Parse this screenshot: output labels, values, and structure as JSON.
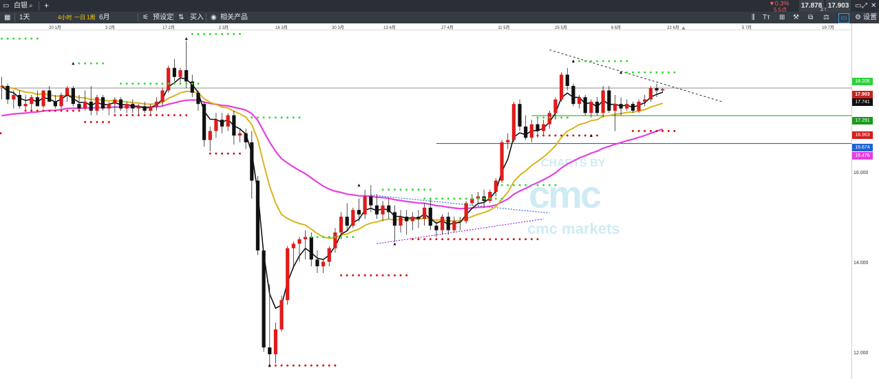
{
  "topbar": {
    "instrument": "白银",
    "change_pct": "▼0.3%",
    "change_pts": "5.5点",
    "bid": "17.878",
    "spread": "2.5",
    "ask": "17.903"
  },
  "toolbar": {
    "timeframe": "1天",
    "periods": [
      "4小时",
      "一日",
      "1周"
    ],
    "range": "6月",
    "presets_label": "预设定",
    "buy_label": "买入",
    "related_label": "相关产品",
    "settings_label": "设置"
  },
  "price_labels": {
    "upper_dots": "18.206",
    "current": "17.903",
    "ma_black": "17.741",
    "green_line": "17.291",
    "lower_dots": "16.963",
    "blue_line": "16.674",
    "magenta_ma": "16.476"
  },
  "watermark": {
    "line1": "CHARTS BY",
    "line2": "cmc markets"
  },
  "colors": {
    "up": "#e01b1b",
    "down": "#111111",
    "ma_fast": "#111111",
    "ma_mid": "#d8b41a",
    "ma_slow": "#e63ee0",
    "dots_high": "#33dd33",
    "dots_low": "#dd1111",
    "support": "#1a9a1a",
    "blue_level": "#1e64d0",
    "trend_blue": "#2a70d8",
    "trend_purple": "#9a2ae0"
  },
  "chart_data": {
    "type": "candlestick",
    "ylim": [
      11.45,
      19.2
    ],
    "y_ticks": [
      "12.000",
      "14.000",
      "16.000"
    ],
    "x_labels": [
      "20 1月",
      "3 2月",
      "17 2月",
      "2 3月",
      "16 3月",
      "30 3月",
      "13 4月",
      "27 4月",
      "11 5月",
      "25 5月",
      "8 6月",
      "22 6月",
      "5 7月",
      "19 7月"
    ],
    "candles": [
      [
        17.95,
        18.15,
        17.65,
        17.95
      ],
      [
        17.95,
        18.0,
        17.55,
        17.65
      ],
      [
        17.65,
        17.85,
        17.45,
        17.75
      ],
      [
        17.75,
        17.85,
        17.45,
        17.5
      ],
      [
        17.5,
        17.75,
        17.4,
        17.55
      ],
      [
        17.55,
        17.75,
        17.4,
        17.7
      ],
      [
        17.7,
        17.85,
        17.5,
        17.5
      ],
      [
        17.5,
        17.85,
        17.45,
        17.85
      ],
      [
        17.85,
        17.95,
        17.6,
        17.6
      ],
      [
        17.6,
        17.75,
        17.45,
        17.5
      ],
      [
        17.5,
        17.8,
        17.45,
        17.75
      ],
      [
        17.75,
        17.95,
        17.6,
        17.9
      ],
      [
        17.9,
        17.95,
        17.5,
        17.55
      ],
      [
        17.55,
        17.75,
        17.4,
        17.45
      ],
      [
        17.45,
        17.85,
        17.4,
        17.6
      ],
      [
        17.6,
        17.95,
        17.3,
        17.4
      ],
      [
        17.4,
        17.75,
        17.3,
        17.7
      ],
      [
        17.7,
        17.75,
        17.4,
        17.45
      ],
      [
        17.45,
        17.6,
        17.3,
        17.55
      ],
      [
        17.55,
        17.7,
        17.35,
        17.65
      ],
      [
        17.65,
        17.7,
        17.4,
        17.45
      ],
      [
        17.45,
        17.6,
        17.35,
        17.55
      ],
      [
        17.55,
        17.65,
        17.35,
        17.45
      ],
      [
        17.45,
        17.55,
        17.3,
        17.5
      ],
      [
        17.5,
        17.6,
        17.35,
        17.4
      ],
      [
        17.4,
        17.55,
        17.3,
        17.5
      ],
      [
        17.5,
        17.7,
        17.4,
        17.6
      ],
      [
        17.6,
        17.9,
        17.5,
        17.85
      ],
      [
        17.85,
        18.4,
        17.8,
        18.35
      ],
      [
        18.35,
        18.55,
        18.05,
        18.15
      ],
      [
        18.15,
        18.35,
        18.0,
        18.3
      ],
      [
        18.3,
        18.95,
        17.9,
        18.05
      ],
      [
        18.05,
        18.2,
        17.7,
        17.8
      ],
      [
        17.8,
        17.85,
        17.4,
        17.55
      ],
      [
        17.55,
        17.6,
        16.6,
        16.75
      ],
      [
        16.75,
        17.05,
        16.5,
        16.95
      ],
      [
        16.95,
        17.35,
        16.8,
        17.2
      ],
      [
        17.2,
        17.35,
        16.9,
        17.05
      ],
      [
        17.05,
        17.35,
        16.95,
        17.3
      ],
      [
        17.3,
        17.4,
        16.65,
        16.85
      ],
      [
        16.85,
        17.0,
        16.7,
        16.9
      ],
      [
        16.9,
        17.0,
        16.55,
        16.7
      ],
      [
        16.7,
        16.95,
        15.45,
        15.85
      ],
      [
        15.85,
        15.95,
        14.2,
        14.3
      ],
      [
        14.3,
        14.3,
        12.05,
        12.15
      ],
      [
        12.15,
        13.55,
        11.75,
        12.0
      ],
      [
        12.0,
        12.7,
        11.8,
        12.55
      ],
      [
        12.55,
        13.3,
        12.5,
        13.2
      ],
      [
        13.2,
        14.4,
        13.1,
        14.35
      ],
      [
        14.35,
        14.5,
        13.9,
        14.45
      ],
      [
        14.45,
        14.6,
        14.05,
        14.55
      ],
      [
        14.55,
        14.75,
        14.1,
        14.6
      ],
      [
        14.6,
        14.7,
        13.95,
        14.1
      ],
      [
        14.1,
        14.3,
        13.8,
        13.95
      ],
      [
        13.95,
        14.1,
        13.8,
        14.05
      ],
      [
        14.05,
        14.4,
        13.95,
        14.35
      ],
      [
        14.35,
        14.8,
        14.25,
        14.7
      ],
      [
        14.7,
        15.15,
        14.55,
        15.05
      ],
      [
        15.05,
        15.35,
        14.75,
        14.85
      ],
      [
        14.85,
        15.25,
        14.8,
        15.2
      ],
      [
        15.2,
        15.45,
        14.95,
        15.1
      ],
      [
        15.1,
        15.65,
        15.0,
        15.5
      ],
      [
        15.5,
        15.75,
        15.15,
        15.3
      ],
      [
        15.3,
        15.55,
        15.0,
        15.1
      ],
      [
        15.1,
        15.4,
        14.95,
        15.3
      ],
      [
        15.3,
        15.45,
        15.0,
        15.15
      ],
      [
        15.15,
        15.3,
        14.5,
        14.85
      ],
      [
        14.85,
        15.2,
        14.7,
        15.05
      ],
      [
        15.05,
        15.2,
        14.65,
        14.95
      ],
      [
        14.95,
        15.15,
        14.75,
        15.05
      ],
      [
        15.05,
        15.2,
        14.8,
        15.0
      ],
      [
        15.0,
        15.35,
        14.85,
        15.25
      ],
      [
        15.25,
        15.45,
        14.75,
        14.85
      ],
      [
        14.85,
        14.95,
        14.6,
        14.75
      ],
      [
        14.75,
        15.1,
        14.65,
        15.05
      ],
      [
        15.05,
        15.15,
        14.65,
        14.75
      ],
      [
        14.75,
        15.05,
        14.7,
        14.95
      ],
      [
        14.95,
        15.05,
        14.75,
        14.95
      ],
      [
        14.95,
        15.4,
        14.9,
        15.35
      ],
      [
        15.35,
        15.55,
        15.3,
        15.45
      ],
      [
        15.45,
        15.6,
        15.35,
        15.5
      ],
      [
        15.5,
        15.65,
        15.25,
        15.4
      ],
      [
        15.4,
        15.65,
        15.35,
        15.6
      ],
      [
        15.6,
        15.9,
        15.5,
        15.85
      ],
      [
        15.85,
        16.75,
        15.8,
        16.7
      ],
      [
        16.7,
        16.9,
        16.55,
        16.75
      ],
      [
        16.75,
        17.6,
        16.7,
        17.55
      ],
      [
        17.55,
        17.65,
        16.95,
        17.05
      ],
      [
        17.05,
        17.3,
        16.75,
        16.8
      ],
      [
        16.8,
        17.2,
        16.7,
        17.1
      ],
      [
        17.1,
        17.25,
        16.8,
        16.95
      ],
      [
        16.95,
        17.2,
        16.85,
        17.1
      ],
      [
        17.1,
        17.4,
        17.0,
        17.35
      ],
      [
        17.35,
        17.7,
        17.2,
        17.65
      ],
      [
        17.65,
        18.25,
        17.6,
        18.2
      ],
      [
        18.2,
        18.35,
        17.85,
        17.95
      ],
      [
        17.95,
        18.0,
        17.5,
        17.55
      ],
      [
        17.55,
        17.75,
        17.45,
        17.7
      ],
      [
        17.7,
        17.75,
        17.3,
        17.35
      ],
      [
        17.35,
        17.65,
        17.25,
        17.6
      ],
      [
        17.6,
        17.7,
        17.3,
        17.35
      ],
      [
        17.35,
        17.95,
        17.25,
        17.85
      ],
      [
        17.85,
        17.95,
        17.35,
        17.4
      ],
      [
        17.4,
        17.75,
        16.95,
        17.55
      ],
      [
        17.55,
        17.7,
        17.3,
        17.45
      ],
      [
        17.45,
        17.65,
        17.4,
        17.55
      ],
      [
        17.55,
        17.6,
        17.35,
        17.4
      ],
      [
        17.4,
        17.65,
        17.35,
        17.6
      ],
      [
        17.6,
        17.75,
        17.5,
        17.65
      ],
      [
        17.65,
        17.95,
        17.6,
        17.9
      ],
      [
        17.9,
        18.0,
        17.7,
        17.85
      ],
      [
        17.85,
        17.9,
        17.8,
        17.88
      ]
    ],
    "overlays": {
      "horizontal_lines": [
        17.903,
        17.291,
        16.674
      ],
      "ma_slow_last": 16.476
    }
  }
}
